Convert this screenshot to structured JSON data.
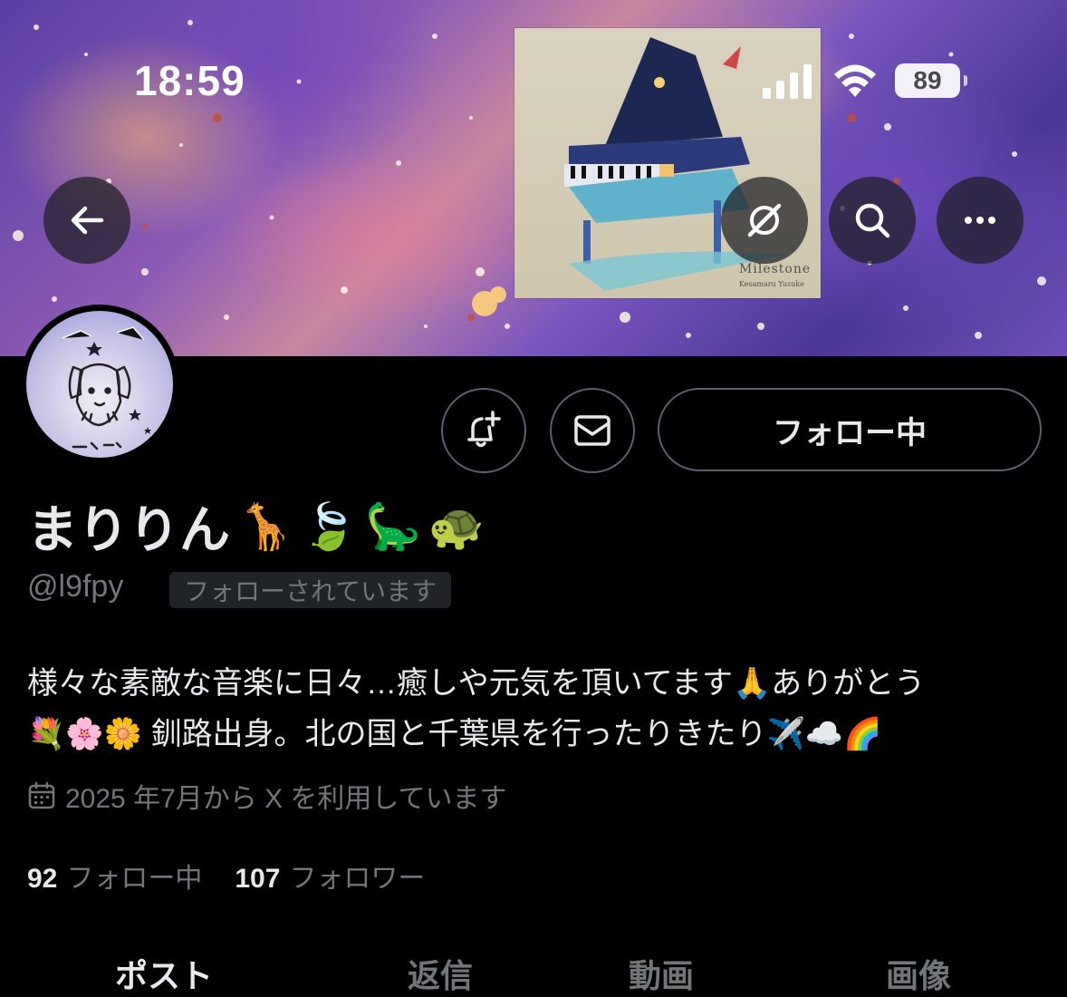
{
  "status_bar": {
    "time": "18:59",
    "battery": "89"
  },
  "album": {
    "title": "Milestone",
    "artist": "Kesamaru Yusuke"
  },
  "actions": {
    "follow_label": "フォロー中"
  },
  "profile": {
    "name": "まりりん",
    "name_emojis": [
      "🦒",
      "🍃",
      "🦕",
      "🐢"
    ],
    "handle": "@l9fpy",
    "follows_you": "フォローされています",
    "bio_line1": "様々な素敵な音楽に日々…癒しや元気を頂いてます🙏ありがとう",
    "bio_line2": "💐🌸🌼 釧路出身。北の国と千葉県を行ったりきたり✈️☁️🌈",
    "joined": "2025 年7月から X を利用しています",
    "following_count": "92",
    "following_label": "フォロー中",
    "followers_count": "107",
    "followers_label": "フォロワー"
  },
  "tabs": [
    {
      "label": "ポスト",
      "active": true
    },
    {
      "label": "返信",
      "active": false
    },
    {
      "label": "動画",
      "active": false
    },
    {
      "label": "画像",
      "active": false
    }
  ],
  "icons": [
    "back-arrow-icon",
    "no-sync-icon",
    "search-icon",
    "more-icon",
    "notification-bell-plus-icon",
    "mail-icon",
    "calendar-icon",
    "signal-icon",
    "wifi-icon"
  ],
  "colors": {
    "background": "#000000",
    "text": "#e7e9ea",
    "secondary": "#71767b",
    "border": "#536471"
  }
}
